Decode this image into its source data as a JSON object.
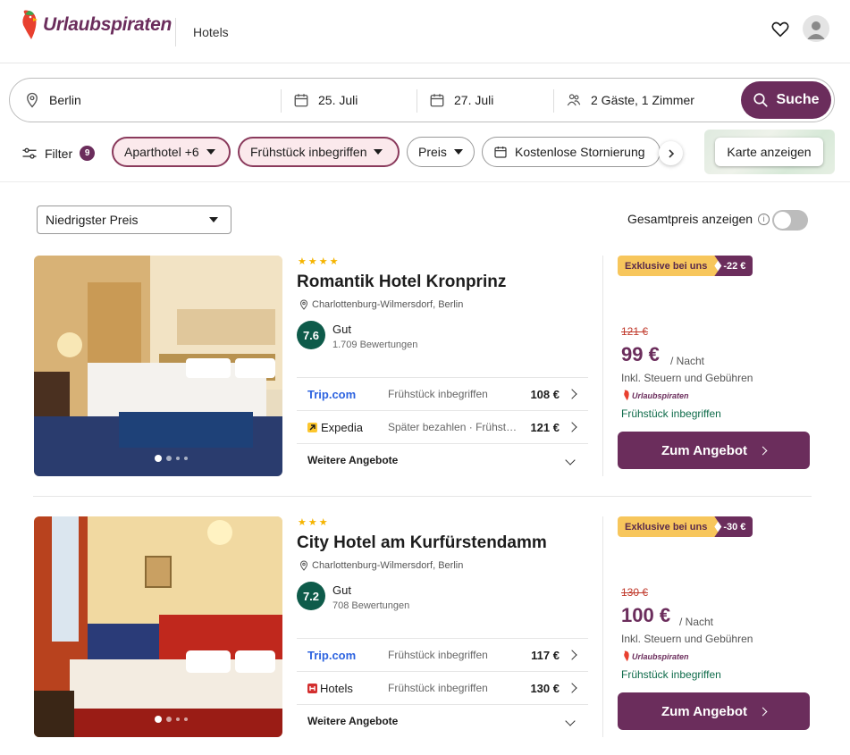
{
  "header": {
    "logo_text": "Urlaubspiraten",
    "section": "Hotels"
  },
  "search": {
    "destination": "Berlin",
    "checkin": "25. Juli",
    "checkout": "27. Juli",
    "guests": "2 Gäste, 1 Zimmer",
    "button_label": "Suche"
  },
  "filters": {
    "filter_label": "Filter",
    "filter_count": "9",
    "chips": [
      {
        "label": "Aparthotel +6",
        "active": true
      },
      {
        "label": "Frühstück inbegriffen",
        "active": true
      },
      {
        "label": "Preis",
        "active": false
      },
      {
        "label": "Kostenlose Stornierung",
        "active": false
      }
    ],
    "map_button": "Karte anzeigen"
  },
  "sort": {
    "selected": "Niedrigster Preis",
    "total_price_label": "Gesamtpreis anzeigen"
  },
  "hotels": [
    {
      "stars": "★★★★",
      "name": "Romantik Hotel Kronprinz",
      "location": "Charlottenburg-Wilmersdorf, Berlin",
      "score": "7.6",
      "rating_word": "Gut",
      "reviews": "1.709 Bewertungen",
      "offers": [
        {
          "provider": "Trip.com",
          "desc": "Frühstück inbegriffen",
          "price": "108 €"
        },
        {
          "provider": "Expedia",
          "desc": "Später bezahlen · Frühstück inbegriffen",
          "price": "121 €"
        }
      ],
      "more_offers": "Weitere Angebote",
      "promo_label": "Exklusive bei uns",
      "promo_discount": "-22 €",
      "old_price": "121 €",
      "price": "99 €",
      "per_night": "/ Nacht",
      "incl": "Inkl. Steuern und Gebühren",
      "partner_logo": "Urlaubspiraten",
      "breakfast": "Frühstück inbegriffen",
      "cta": "Zum Angebot"
    },
    {
      "stars": "★★★",
      "name": "City Hotel am Kurfürstendamm",
      "location": "Charlottenburg-Wilmersdorf, Berlin",
      "score": "7.2",
      "rating_word": "Gut",
      "reviews": "708 Bewertungen",
      "offers": [
        {
          "provider": "Trip.com",
          "desc": "Frühstück inbegriffen",
          "price": "117 €"
        },
        {
          "provider": "Hotels",
          "desc": "Frühstück inbegriffen",
          "price": "130 €"
        }
      ],
      "more_offers": "Weitere Angebote",
      "promo_label": "Exklusive bei uns",
      "promo_discount": "-30 €",
      "old_price": "130 €",
      "price": "100 €",
      "per_night": "/ Nacht",
      "incl": "Inkl. Steuern und Gebühren",
      "partner_logo": "Urlaubspiraten",
      "breakfast": "Frühstück inbegriffen",
      "cta": "Zum Angebot"
    }
  ],
  "colors": {
    "brand": "#6b2d5c",
    "score_green": "#0e5b4a",
    "promo_yellow": "#f7c65c",
    "strike_red": "#c0392b"
  }
}
